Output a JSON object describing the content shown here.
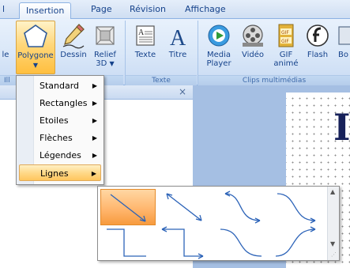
{
  "tabs": [
    {
      "label": "l",
      "active": false
    },
    {
      "label": "Insertion",
      "active": true
    },
    {
      "label": "Page",
      "active": false
    },
    {
      "label": "Révision",
      "active": false
    },
    {
      "label": "Affichage",
      "active": false
    }
  ],
  "ribbon": {
    "buttons": [
      {
        "label": "le",
        "icon": "partial-icon"
      },
      {
        "label": "Polygone",
        "icon": "pentagon-icon",
        "active": true
      },
      {
        "label": "Dessin",
        "icon": "pencil-icon"
      },
      {
        "label": "Relief",
        "label2": "3D",
        "icon": "relief-3d-icon"
      },
      {
        "label": "Texte",
        "icon": "text-box-icon"
      },
      {
        "label": "Titre",
        "icon": "title-letter-icon"
      },
      {
        "label": "Media",
        "label2": "Player",
        "icon": "media-player-icon"
      },
      {
        "label": "Vidéo",
        "icon": "video-reel-icon"
      },
      {
        "label": "GIF",
        "label2": "animé",
        "icon": "gif-icon"
      },
      {
        "label": "Flash",
        "icon": "flash-icon"
      },
      {
        "label": "Bo",
        "icon": "partial-icon"
      }
    ],
    "groups": [
      "Ill",
      "Texte",
      "Clips multimédias"
    ]
  },
  "panel": {
    "close": "×"
  },
  "menu": {
    "items": [
      {
        "label": "Standard",
        "arrow": "▶"
      },
      {
        "label": "Rectangles",
        "arrow": "▶"
      },
      {
        "label": "Etoiles",
        "arrow": "▶"
      },
      {
        "label": "Flèches",
        "arrow": "▶"
      },
      {
        "label": "Légendes",
        "arrow": "▶"
      },
      {
        "label": "Lignes",
        "arrow": "▶",
        "highlighted": true
      }
    ]
  },
  "gallery": {
    "items": [
      {
        "name": "straight-arrow-line",
        "selected": true
      },
      {
        "name": "double-arrow-line"
      },
      {
        "name": "curved-arrow-line"
      },
      {
        "name": "curved-line"
      },
      {
        "name": "elbow-connector"
      },
      {
        "name": "elbow-arrow-connector"
      },
      {
        "name": "curved-connector"
      },
      {
        "name": "curved-arrow-connector"
      }
    ],
    "scroll_up": "▲",
    "scroll_down": "▼"
  },
  "document": {
    "visible_letter": "I"
  },
  "colors": {
    "accent": "#ffc65e",
    "ribbon": "#d9e7f8",
    "text": "#15428b"
  }
}
